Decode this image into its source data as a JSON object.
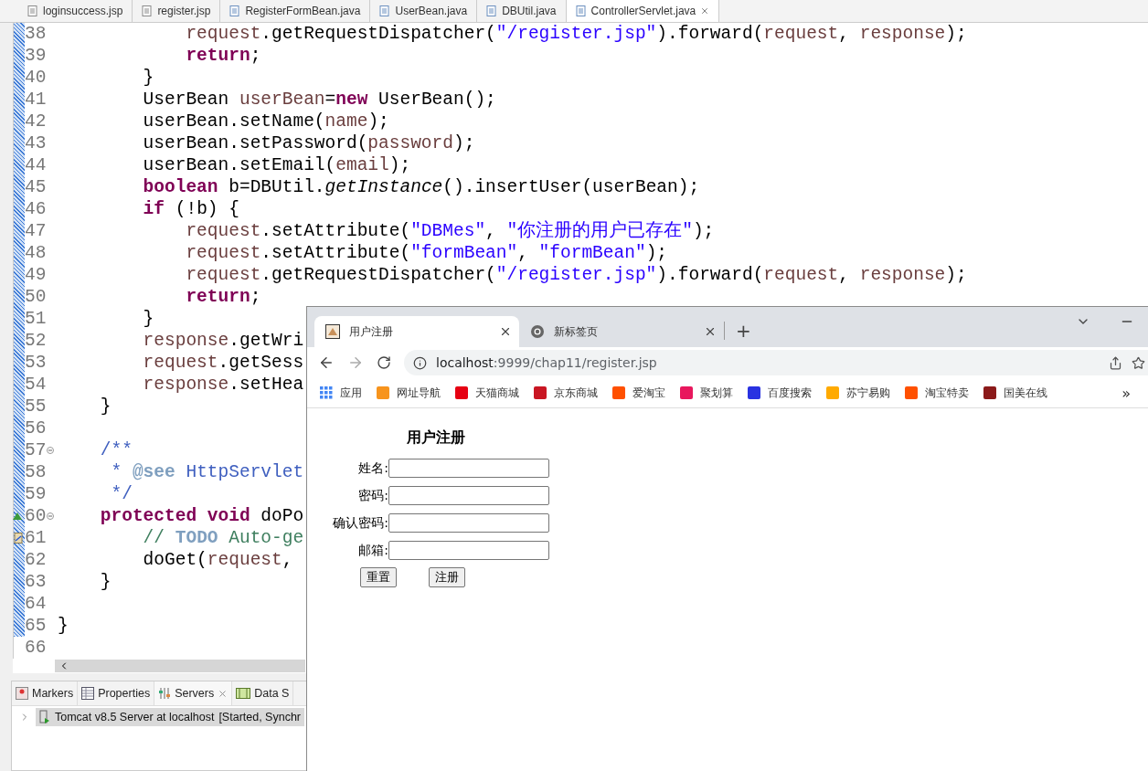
{
  "editor": {
    "tabs": [
      {
        "label": "loginsuccess.jsp",
        "kind": "jsp",
        "selected": false
      },
      {
        "label": "register.jsp",
        "kind": "jsp",
        "selected": false
      },
      {
        "label": "RegisterFormBean.java",
        "kind": "java",
        "selected": false
      },
      {
        "label": "UserBean.java",
        "kind": "java",
        "selected": false
      },
      {
        "label": "DBUtil.java",
        "kind": "java",
        "selected": false
      },
      {
        "label": "ControllerServlet.java",
        "kind": "java",
        "selected": true
      }
    ],
    "code_lines": [
      {
        "number": "38",
        "fold": false,
        "kind": "plain",
        "tokens": [
          {
            "kind": "var",
            "text": "            request"
          },
          {
            "kind": "plain",
            "text": ".getRequestDispatcher("
          },
          {
            "kind": "string",
            "text": "\"/register.jsp\""
          },
          {
            "kind": "plain",
            "text": ").forward("
          },
          {
            "kind": "var",
            "text": "request"
          },
          {
            "kind": "plain",
            "text": ", "
          },
          {
            "kind": "var",
            "text": "response"
          },
          {
            "kind": "plain",
            "text": ");"
          }
        ]
      },
      {
        "number": "39",
        "fold": false,
        "kind": "plain",
        "tokens": [
          {
            "kind": "keyword",
            "text": "            return"
          },
          {
            "kind": "plain",
            "text": ";"
          }
        ]
      },
      {
        "number": "40",
        "fold": false,
        "kind": "plain",
        "tokens": [
          {
            "kind": "plain",
            "text": "        }"
          }
        ]
      },
      {
        "number": "41",
        "fold": false,
        "kind": "plain",
        "tokens": [
          {
            "kind": "plain",
            "text": "        UserBean "
          },
          {
            "kind": "var",
            "text": "userBean"
          },
          {
            "kind": "plain",
            "text": "="
          },
          {
            "kind": "keyword",
            "text": "new"
          },
          {
            "kind": "plain",
            "text": " UserBean();"
          }
        ]
      },
      {
        "number": "42",
        "fold": false,
        "kind": "plain",
        "tokens": [
          {
            "kind": "plain",
            "text": "        userBean.setName("
          },
          {
            "kind": "var",
            "text": "name"
          },
          {
            "kind": "plain",
            "text": ");"
          }
        ]
      },
      {
        "number": "43",
        "fold": false,
        "kind": "plain",
        "tokens": [
          {
            "kind": "plain",
            "text": "        userBean.setPassword("
          },
          {
            "kind": "var",
            "text": "password"
          },
          {
            "kind": "plain",
            "text": ");"
          }
        ]
      },
      {
        "number": "44",
        "fold": false,
        "kind": "plain",
        "tokens": [
          {
            "kind": "plain",
            "text": "        userBean.setEmail("
          },
          {
            "kind": "var",
            "text": "email"
          },
          {
            "kind": "plain",
            "text": ");"
          }
        ]
      },
      {
        "number": "45",
        "fold": false,
        "kind": "plain",
        "tokens": [
          {
            "kind": "keyword",
            "text": "        boolean"
          },
          {
            "kind": "plain",
            "text": " b=DBUtil."
          },
          {
            "kind": "italic",
            "text": "getInstance"
          },
          {
            "kind": "plain",
            "text": "().insertUser(userBean);"
          }
        ]
      },
      {
        "number": "46",
        "fold": false,
        "kind": "plain",
        "tokens": [
          {
            "kind": "keyword",
            "text": "        if"
          },
          {
            "kind": "plain",
            "text": " (!b) {"
          }
        ]
      },
      {
        "number": "47",
        "fold": false,
        "kind": "plain",
        "tokens": [
          {
            "kind": "var",
            "text": "            request"
          },
          {
            "kind": "plain",
            "text": ".setAttribute("
          },
          {
            "kind": "string",
            "text": "\"DBMes\""
          },
          {
            "kind": "plain",
            "text": ", "
          },
          {
            "kind": "string",
            "text": "\"你注册的用户已存在\""
          },
          {
            "kind": "plain",
            "text": ");"
          }
        ]
      },
      {
        "number": "48",
        "fold": false,
        "kind": "plain",
        "tokens": [
          {
            "kind": "var",
            "text": "            request"
          },
          {
            "kind": "plain",
            "text": ".setAttribute("
          },
          {
            "kind": "string",
            "text": "\"formBean\""
          },
          {
            "kind": "plain",
            "text": ", "
          },
          {
            "kind": "string",
            "text": "\"formBean\""
          },
          {
            "kind": "plain",
            "text": ");"
          }
        ]
      },
      {
        "number": "49",
        "fold": false,
        "kind": "plain",
        "tokens": [
          {
            "kind": "var",
            "text": "            request"
          },
          {
            "kind": "plain",
            "text": ".getRequestDispatcher("
          },
          {
            "kind": "string",
            "text": "\"/register.jsp\""
          },
          {
            "kind": "plain",
            "text": ").forward("
          },
          {
            "kind": "var",
            "text": "request"
          },
          {
            "kind": "plain",
            "text": ", "
          },
          {
            "kind": "var",
            "text": "response"
          },
          {
            "kind": "plain",
            "text": ");"
          }
        ]
      },
      {
        "number": "50",
        "fold": false,
        "kind": "plain",
        "tokens": [
          {
            "kind": "keyword",
            "text": "            return"
          },
          {
            "kind": "plain",
            "text": ";"
          }
        ]
      },
      {
        "number": "51",
        "fold": false,
        "kind": "plain",
        "tokens": [
          {
            "kind": "plain",
            "text": "        }"
          }
        ]
      },
      {
        "number": "52",
        "fold": false,
        "kind": "plain",
        "tokens": [
          {
            "kind": "var",
            "text": "        response"
          },
          {
            "kind": "plain",
            "text": ".getWri"
          }
        ]
      },
      {
        "number": "53",
        "fold": false,
        "kind": "plain",
        "tokens": [
          {
            "kind": "var",
            "text": "        request"
          },
          {
            "kind": "plain",
            "text": ".getSess"
          }
        ]
      },
      {
        "number": "54",
        "fold": false,
        "kind": "plain",
        "tokens": [
          {
            "kind": "var",
            "text": "        response"
          },
          {
            "kind": "plain",
            "text": ".setHea"
          }
        ]
      },
      {
        "number": "55",
        "fold": false,
        "kind": "plain",
        "tokens": [
          {
            "kind": "plain",
            "text": "    }"
          }
        ]
      },
      {
        "number": "56",
        "fold": false,
        "kind": "plain"
      },
      {
        "number": "57",
        "fold": true,
        "kind": "plain",
        "tokens": [
          {
            "kind": "doc",
            "text": "    /**"
          }
        ]
      },
      {
        "number": "58",
        "fold": false,
        "kind": "plain",
        "tokens": [
          {
            "kind": "doc",
            "text": "     * "
          },
          {
            "kind": "doctag",
            "text": "@see"
          },
          {
            "kind": "doc",
            "text": " HttpServlet"
          }
        ]
      },
      {
        "number": "59",
        "fold": false,
        "kind": "plain",
        "tokens": [
          {
            "kind": "doc",
            "text": "     */"
          }
        ]
      },
      {
        "number": "60",
        "fold": true,
        "kind": "override",
        "tokens": [
          {
            "kind": "keyword",
            "text": "    protected"
          },
          {
            "kind": "keyword",
            "text": " void"
          },
          {
            "kind": "plain",
            "text": " doPo"
          }
        ]
      },
      {
        "number": "61",
        "fold": false,
        "kind": "task",
        "tokens": [
          {
            "kind": "comment",
            "text": "        // "
          },
          {
            "kind": "todo",
            "text": "TODO"
          },
          {
            "kind": "comment",
            "text": " Auto-ge"
          }
        ]
      },
      {
        "number": "62",
        "fold": false,
        "kind": "plain",
        "tokens": [
          {
            "kind": "plain",
            "text": "        doGet("
          },
          {
            "kind": "var",
            "text": "request"
          },
          {
            "kind": "plain",
            "text": ","
          }
        ]
      },
      {
        "number": "63",
        "fold": false,
        "kind": "plain",
        "tokens": [
          {
            "kind": "plain",
            "text": "    }"
          }
        ]
      },
      {
        "number": "64",
        "fold": false,
        "kind": "plain"
      },
      {
        "number": "65",
        "fold": false,
        "kind": "plain",
        "tokens": [
          {
            "kind": "plain",
            "text": "}"
          }
        ]
      },
      {
        "number": "66",
        "fold": false,
        "kind": "plain"
      }
    ]
  },
  "bottom_panel": {
    "tabs": [
      {
        "label": "Markers",
        "selected": false
      },
      {
        "label": "Properties",
        "selected": false
      },
      {
        "label": "Servers",
        "selected": true
      },
      {
        "label": "Data S",
        "selected": false
      }
    ],
    "servers": [
      {
        "name": "Tomcat v8.5 Server at localhost",
        "status": "[Started, Synchr",
        "expanded": false,
        "selected": true
      }
    ]
  },
  "browser": {
    "tabs": [
      {
        "title": "用户注册",
        "selected": true
      },
      {
        "title": "新标签页",
        "selected": false
      }
    ],
    "new_tab": "+",
    "address": {
      "host": "localhost",
      "path": ":9999/chap11/register.jsp"
    },
    "bookmarks": [
      {
        "label": "应用",
        "color": "#4285f4"
      },
      {
        "label": "网址导航",
        "color": "#f7941d"
      },
      {
        "label": "天猫商城",
        "color": "#e60012"
      },
      {
        "label": "京东商城",
        "color": "#c91623"
      },
      {
        "label": "爱淘宝",
        "color": "#ff5000"
      },
      {
        "label": "聚划算",
        "color": "#e8175d"
      },
      {
        "label": "百度搜索",
        "color": "#2932e1"
      },
      {
        "label": "苏宁易购",
        "color": "#ffaa00"
      },
      {
        "label": "淘宝特卖",
        "color": "#ff5000"
      },
      {
        "label": "国美在线",
        "color": "#8b1a1a"
      }
    ],
    "bookmarks_more": "»",
    "page": {
      "heading": "用户注册",
      "fields": [
        {
          "label": "姓名:"
        },
        {
          "label": "密码:"
        },
        {
          "label": "确认密码:"
        },
        {
          "label": "邮箱:"
        }
      ],
      "buttons": [
        "重置",
        "注册"
      ]
    }
  }
}
